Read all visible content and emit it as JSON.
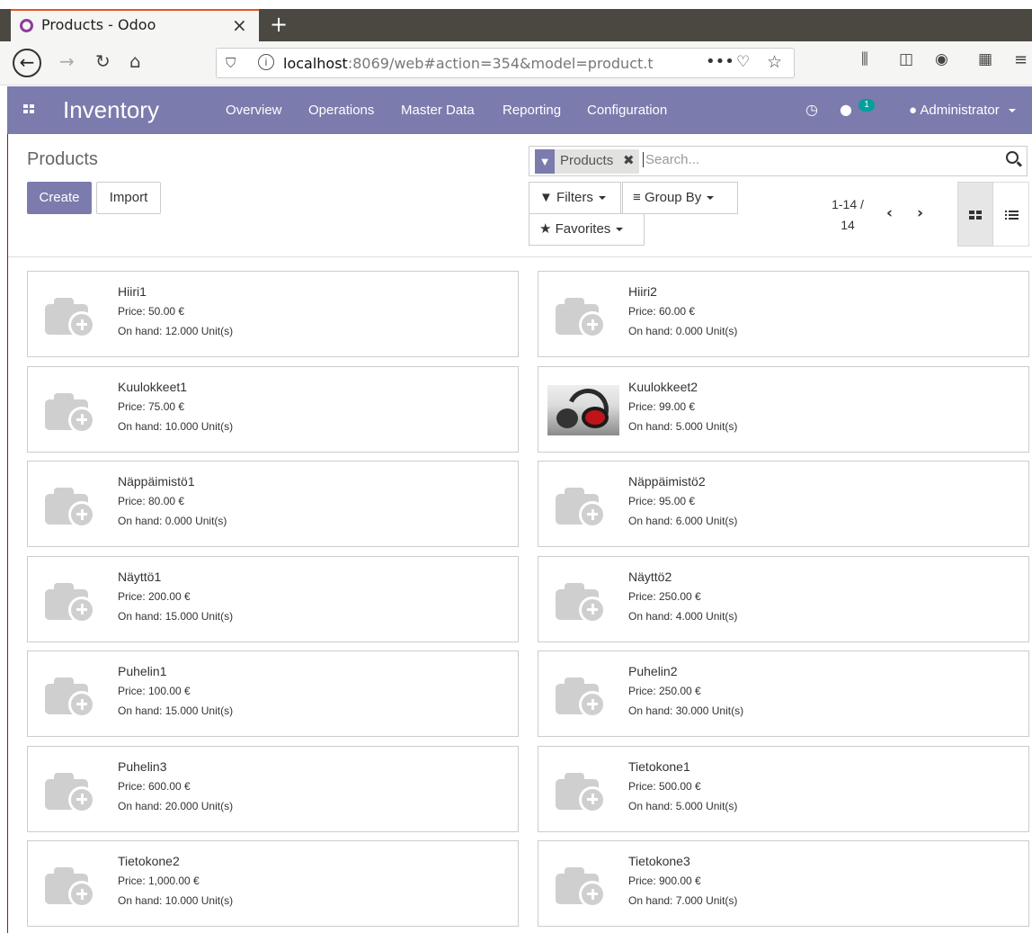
{
  "browser": {
    "tab_title": "Products - Odoo",
    "tab_close": "×",
    "new_tab": "+",
    "url_host": "localhost",
    "url_rest": ":8069/web#action=354&model=product.t",
    "url_more": "•••"
  },
  "odoo_nav": {
    "brand": "Inventory",
    "menus": [
      "Overview",
      "Operations",
      "Master Data",
      "Reporting",
      "Configuration"
    ],
    "messages_count": "1",
    "user": "Administrator"
  },
  "control_panel": {
    "breadcrumb": "Products",
    "create_label": "Create",
    "import_label": "Import",
    "facet_label": "Products",
    "search_placeholder": "Search...",
    "filters_label": "Filters",
    "groupby_label": "Group By",
    "favorites_label": "Favorites",
    "pager_range": "1-14 /",
    "pager_total": "14"
  },
  "products": [
    {
      "name": "Hiiri1",
      "price": "Price: 50.00 €",
      "onhand": "On hand: 12.000 Unit(s)",
      "image": "placeholder"
    },
    {
      "name": "Hiiri2",
      "price": "Price: 60.00 €",
      "onhand": "On hand: 0.000 Unit(s)",
      "image": "placeholder"
    },
    {
      "name": "Kuulokkeet1",
      "price": "Price: 75.00 €",
      "onhand": "On hand: 10.000 Unit(s)",
      "image": "placeholder"
    },
    {
      "name": "Kuulokkeet2",
      "price": "Price: 99.00 €",
      "onhand": "On hand: 5.000 Unit(s)",
      "image": "headphones-photo"
    },
    {
      "name": "Näppäimistö1",
      "price": "Price: 80.00 €",
      "onhand": "On hand: 0.000 Unit(s)",
      "image": "placeholder"
    },
    {
      "name": "Näppäimistö2",
      "price": "Price: 95.00 €",
      "onhand": "On hand: 6.000 Unit(s)",
      "image": "placeholder"
    },
    {
      "name": "Näyttö1",
      "price": "Price: 200.00 €",
      "onhand": "On hand: 15.000 Unit(s)",
      "image": "placeholder"
    },
    {
      "name": "Näyttö2",
      "price": "Price: 250.00 €",
      "onhand": "On hand: 4.000 Unit(s)",
      "image": "placeholder"
    },
    {
      "name": "Puhelin1",
      "price": "Price: 100.00 €",
      "onhand": "On hand: 15.000 Unit(s)",
      "image": "placeholder"
    },
    {
      "name": "Puhelin2",
      "price": "Price: 250.00 €",
      "onhand": "On hand: 30.000 Unit(s)",
      "image": "placeholder"
    },
    {
      "name": "Puhelin3",
      "price": "Price: 600.00 €",
      "onhand": "On hand: 20.000 Unit(s)",
      "image": "placeholder"
    },
    {
      "name": "Tietokone1",
      "price": "Price: 500.00 €",
      "onhand": "On hand: 5.000 Unit(s)",
      "image": "placeholder"
    },
    {
      "name": "Tietokone2",
      "price": "Price: 1,000.00 €",
      "onhand": "On hand: 10.000 Unit(s)",
      "image": "placeholder"
    },
    {
      "name": "Tietokone3",
      "price": "Price: 900.00 €",
      "onhand": "On hand: 7.000 Unit(s)",
      "image": "placeholder"
    }
  ],
  "colors": {
    "brand_purple": "#7c7bad",
    "badge_teal": "#00a09d",
    "tab_accent": "#e95420"
  }
}
